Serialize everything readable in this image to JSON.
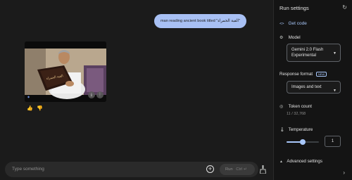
{
  "chat": {
    "user_message": "man reading ancient book titled \"القبة الحمراء\"",
    "image_book_title": "القبة الحمراء",
    "prompt_placeholder": "Type something",
    "run_label": "Run",
    "run_shortcut": "Ctrl ↵",
    "icons": {
      "thumb_up": "👍",
      "thumb_down": "👎",
      "add": "+",
      "image_download": "⤓",
      "image_more": "⋮",
      "image_marker": "◆"
    }
  },
  "settings": {
    "title": "Run settings",
    "refresh_icon": "↻",
    "get_code_icon": "<>",
    "get_code_label": "Get code",
    "model_label": "Model",
    "model_icon": "⚙",
    "model_value": "Gemini 2.0 Flash Experimental",
    "caret": "▼",
    "output_format_label": "Response format",
    "new_badge": "NEW",
    "output_format_value": "Images and text",
    "token_label": "Token count",
    "token_icon": "◎",
    "token_value": "11 / 32,768",
    "temperature_label": "Temperature",
    "temperature_icon": "🌡",
    "temperature_value": "1",
    "temperature_fraction": 0.5,
    "advanced_label": "Advanced settings",
    "advanced_icon": "▲",
    "expand_icon": "›"
  },
  "colors": {
    "accent": "#a8c7fa",
    "bubble": "#a8c0f4",
    "background": "#1b1b1b"
  }
}
